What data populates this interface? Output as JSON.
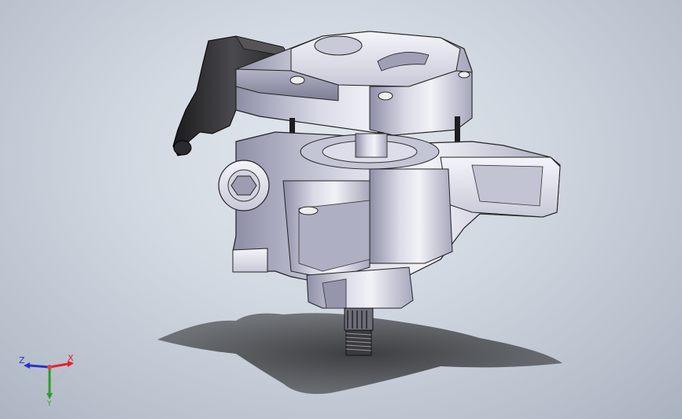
{
  "viewport": {
    "background_top": "#e3e8ef",
    "background_bottom": "#a9b2bf"
  },
  "model": {
    "icon": "power-steering-pump-3d-model"
  },
  "triad": {
    "x_label": "X",
    "y_label": "Y",
    "z_label": "Z",
    "x_color": "#e0242a",
    "y_color": "#2e9c2e",
    "z_color": "#2535c8"
  }
}
